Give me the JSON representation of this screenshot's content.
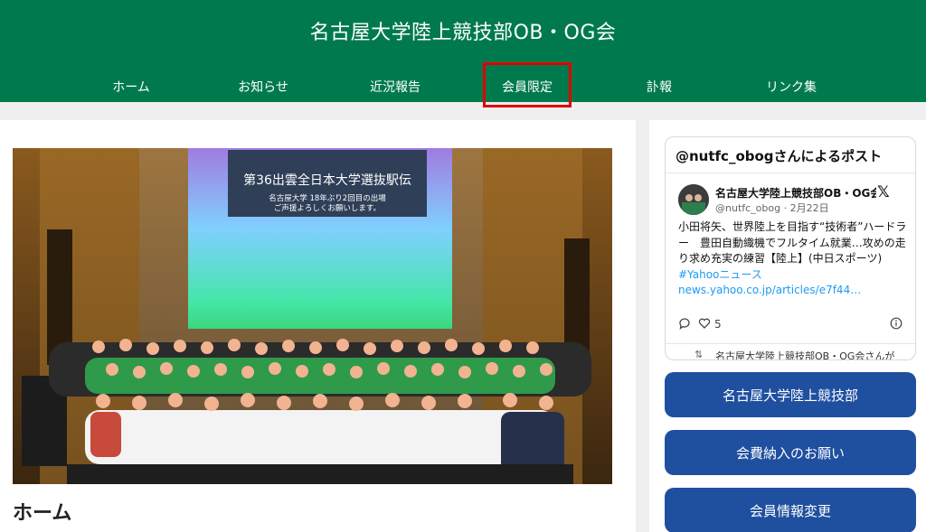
{
  "header": {
    "title": "名古屋大学陸上競技部OB・OG会",
    "nav": [
      "ホーム",
      "お知らせ",
      "近況報告",
      "会員限定",
      "訃報",
      "リンク集"
    ]
  },
  "main": {
    "photo": {
      "screen_title": "第36出雲全日本大学選抜駅伝",
      "screen_sub1": "名古屋大学 18年ぶり2回目の出場",
      "screen_sub2": "ご声援よろしくお願いします。"
    },
    "heading": "ホーム"
  },
  "sidebar": {
    "embed": {
      "header": "@nutfc_obogさんによるポスト",
      "post": {
        "name": "名古屋大学陸上競技部OB・OG会",
        "handle": "@nutfc_obog · 2月22日",
        "text": "小田将矢、世界陸上を目指す“技術者”ハードラー　豊田自動織機でフルタイム就業…攻めの走り求め充実の練習【陸上】(中日スポーツ)",
        "tag": "#Yahooニュース",
        "link": "news.yahoo.co.jp/articles/e7f44…",
        "likes": "5"
      },
      "retweet": "名古屋大学陸上競技部OB・OG会さんが"
    },
    "buttons": [
      "名古屋大学陸上競技部",
      "会費納入のお願い",
      "会員情報変更"
    ]
  }
}
